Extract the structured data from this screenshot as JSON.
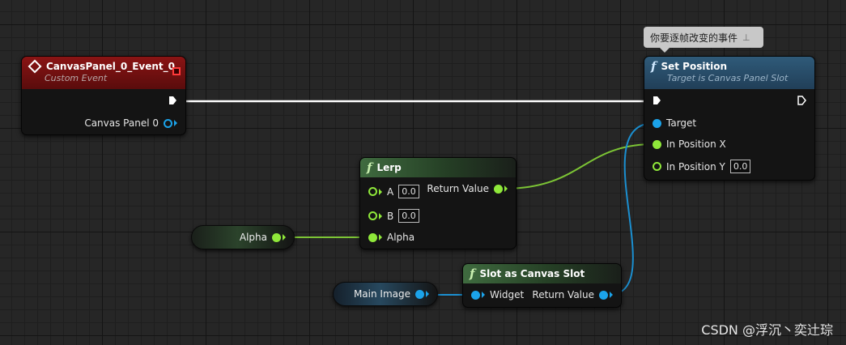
{
  "comment": {
    "text": "你要逐帧改变的事件",
    "pin_icon": "pushpin-icon"
  },
  "custom_event": {
    "title": "CanvasPanel_0_Event_0",
    "subtitle": "Custom Event",
    "output_pin": "Canvas Panel 0",
    "icon": "event-diamond-icon"
  },
  "set_position": {
    "title": "Set Position",
    "subtitle": "Target is Canvas Panel Slot",
    "pins": {
      "target": "Target",
      "in_x": "In Position X",
      "in_y": "In Position Y",
      "in_y_value": "0.0"
    },
    "icon": "function-icon"
  },
  "lerp": {
    "title": "Lerp",
    "pins": {
      "a": "A",
      "a_value": "0.0",
      "b": "B",
      "b_value": "0.0",
      "alpha": "Alpha",
      "return": "Return Value"
    },
    "icon": "function-icon"
  },
  "alpha_var": {
    "label": "Alpha"
  },
  "slot_as_canvas": {
    "title": "Slot as Canvas Slot",
    "pins": {
      "widget": "Widget",
      "return": "Return Value"
    },
    "icon": "function-icon"
  },
  "main_image_var": {
    "label": "Main Image"
  },
  "watermark": "CSDN @浮沉丶奕辻琮",
  "colors": {
    "exec": "#ffffff",
    "float": "#8fe83a",
    "object": "#1ba3ea",
    "event_header": "#8a1414",
    "function_header": "#2f5a79",
    "pure_header": "#3f6b3f"
  }
}
